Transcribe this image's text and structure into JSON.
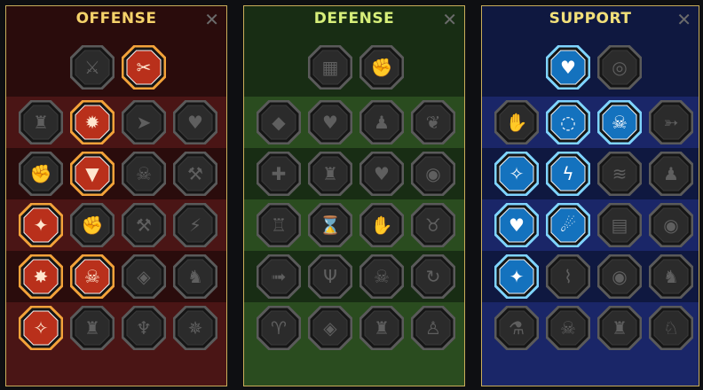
{
  "panels": {
    "offense": {
      "title": "OFFENSE",
      "close": "✕"
    },
    "defense": {
      "title": "DEFENSE",
      "close": "✕"
    },
    "support": {
      "title": "SUPPORT",
      "close": "✕"
    }
  },
  "colors": {
    "locked_fill": "#2b2b2b",
    "locked_stroke": "#5a5a5a",
    "offense_fill": "#c2321c",
    "offense_stroke": "#f3a23a",
    "support_fill": "#1478c8",
    "support_stroke": "#7fd4ff"
  },
  "icons": {
    "offense": [
      [
        "crossed-swords-icon",
        "blade-slash-icon"
      ],
      [
        "winged-helm-icon",
        "fire-burst-icon",
        "shield-arrow-icon",
        "heart-bolt-icon"
      ],
      [
        "flexed-arm-icon",
        "fanged-maw-icon",
        "skull-wind-icon",
        "axe-strike-icon"
      ],
      [
        "blade-drop-icon",
        "fist-punch-icon",
        "dual-axes-icon",
        "chain-bolt-icon"
      ],
      [
        "spear-burst-icon",
        "skull-crown-icon",
        "shield-stripes-icon",
        "warrior-stance-icon"
      ],
      [
        "sword-sparkle-icon",
        "knight-helm-icon",
        "demon-icon",
        "spiked-shield-icon"
      ]
    ],
    "defense": [
      [
        "brick-wall-icon",
        "raised-fist-icon"
      ],
      [
        "chevron-shield-icon",
        "heart-shield-icon",
        "muscle-man-icon",
        "leaf-blade-icon"
      ],
      [
        "healer-icon",
        "knight-shield-icon",
        "skull-heart-icon",
        "halo-head-icon"
      ],
      [
        "tower-icon",
        "hourglass-sun-icon",
        "open-hand-icon",
        "bull-head-icon"
      ],
      [
        "runner-icon",
        "triple-claw-icon",
        "spiked-skull-icon",
        "cycle-strike-icon"
      ],
      [
        "horned-head-icon",
        "winged-shield-icon",
        "helmet-face-icon",
        "meditating-man-icon"
      ]
    ],
    "support": [
      [
        "heart-plus-icon",
        "swirl-eye-icon"
      ],
      [
        "praying-hands-icon",
        "shield-wave-icon",
        "flame-skull-icon",
        "wing-arrow-icon"
      ],
      [
        "ascension-icon",
        "lightning-shield-icon",
        "wind-streak-icon",
        "silhouette-icon"
      ],
      [
        "heart-chain-icon",
        "comet-icon",
        "open-book-icon",
        "evil-eyes-icon"
      ],
      [
        "star-compass-icon",
        "running-boot-icon",
        "all-seeing-eye-icon",
        "dancer-icon"
      ],
      [
        "poison-potion-icon",
        "skull-icon",
        "spartan-helm-icon",
        "eagle-head-icon"
      ]
    ]
  }
}
